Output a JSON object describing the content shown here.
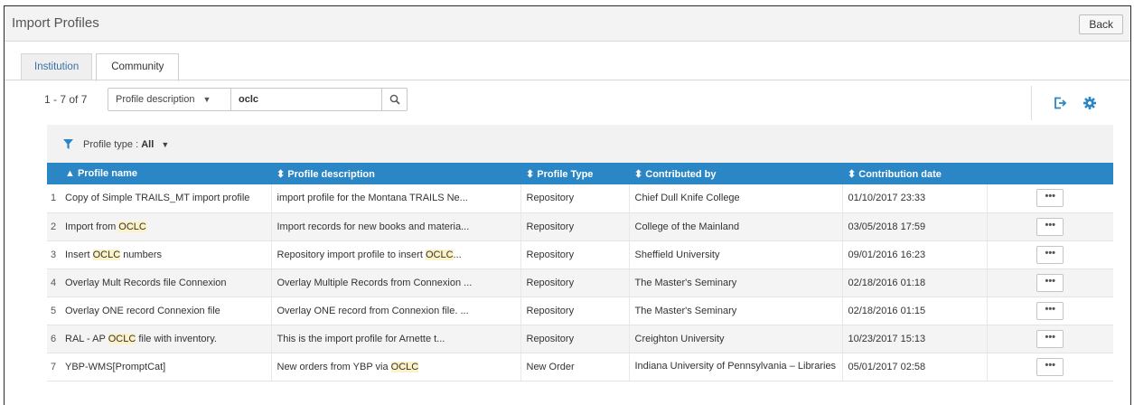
{
  "header": {
    "title": "Import Profiles",
    "back_label": "Back"
  },
  "tabs": [
    {
      "label": "Institution",
      "active": false
    },
    {
      "label": "Community",
      "active": true
    }
  ],
  "toolbar": {
    "count": "1 - 7 of 7",
    "scope": "Profile description",
    "search_value": "oclc",
    "icons": [
      "search-icon",
      "export-icon",
      "gear-icon"
    ]
  },
  "filter": {
    "label": "Profile type :",
    "value": "All"
  },
  "table": {
    "columns": [
      {
        "label": "▲ Profile name"
      },
      {
        "label": "⬍ Profile description"
      },
      {
        "label": "⬍ Profile Type"
      },
      {
        "label": "⬍ Contributed by"
      },
      {
        "label": "⬍ Contribution date"
      }
    ],
    "more_label": "•••",
    "rows": [
      {
        "num": "1",
        "name": [
          {
            "t": "Copy of Simple TRAILS_MT import profile"
          }
        ],
        "desc": [
          {
            "t": "import profile for the Montana TRAILS Ne..."
          }
        ],
        "type": "Repository",
        "by": "Chief Dull Knife College",
        "date": "01/10/2017 23:33"
      },
      {
        "num": "2",
        "name": [
          {
            "t": "Import from "
          },
          {
            "t": "OCLC",
            "hl": true
          }
        ],
        "desc": [
          {
            "t": "Import records for new books and materia..."
          }
        ],
        "type": "Repository",
        "by": "College of the Mainland",
        "date": "03/05/2018 17:59"
      },
      {
        "num": "3",
        "name": [
          {
            "t": "Insert "
          },
          {
            "t": "OCLC",
            "hl": true
          },
          {
            "t": " numbers"
          }
        ],
        "desc": [
          {
            "t": "Repository import profile to insert "
          },
          {
            "t": "OCLC",
            "hl": true
          },
          {
            "t": "..."
          }
        ],
        "type": "Repository",
        "by": "Sheffield University",
        "date": "09/01/2016 16:23"
      },
      {
        "num": "4",
        "name": [
          {
            "t": "Overlay Mult Records file Connexion"
          }
        ],
        "desc": [
          {
            "t": "Overlay Multiple Records from Connexion ..."
          }
        ],
        "type": "Repository",
        "by": "The Master's Seminary",
        "date": "02/18/2016 01:18"
      },
      {
        "num": "5",
        "name": [
          {
            "t": "Overlay ONE record Connexion file"
          }
        ],
        "desc": [
          {
            "t": "Overlay ONE record from Connexion file. ..."
          }
        ],
        "type": "Repository",
        "by": "The Master's Seminary",
        "date": "02/18/2016 01:15"
      },
      {
        "num": "6",
        "name": [
          {
            "t": "RAL - AP "
          },
          {
            "t": "OCLC",
            "hl": true
          },
          {
            "t": " file with inventory."
          }
        ],
        "desc": [
          {
            "t": "This is the import profile for Arnette t..."
          }
        ],
        "type": "Repository",
        "by": "Creighton University",
        "date": "10/23/2017 15:13"
      },
      {
        "num": "7",
        "name": [
          {
            "t": "YBP-WMS[PromptCat]"
          }
        ],
        "desc": [
          {
            "t": "New orders from YBP via "
          },
          {
            "t": "OCLC",
            "hl": true
          }
        ],
        "type": "New Order",
        "by": "Indiana University of Pennsylvania – Libraries",
        "date": "05/01/2017 02:58"
      }
    ]
  },
  "colors": {
    "header_blue": "#2a86c5",
    "highlight": "#fdf1c6",
    "link": "#3a6fa8"
  }
}
